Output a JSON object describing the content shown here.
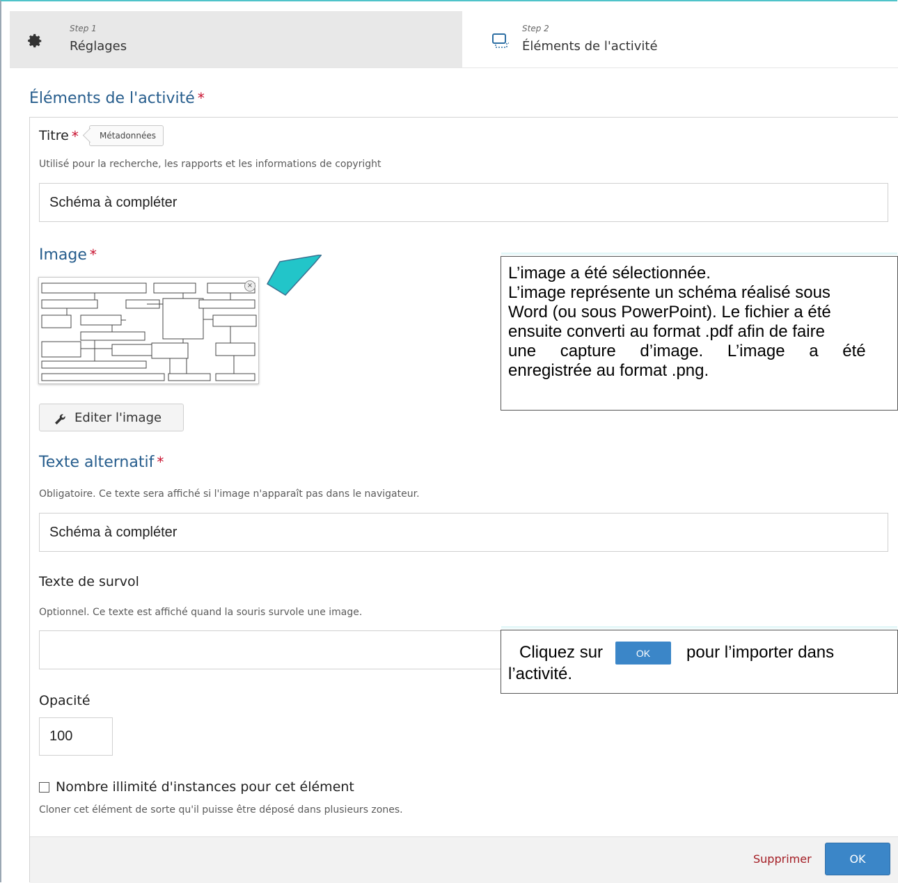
{
  "steps": [
    {
      "small": "Step 1",
      "label": "Réglages"
    },
    {
      "small": "Step 2",
      "label": "Éléments de l'activité"
    }
  ],
  "heading": "Éléments de l'activité",
  "titre": {
    "label": "Titre",
    "tag": "Métadonnées",
    "desc": "Utilisé pour la recherche, les rapports et les informations de copyright",
    "value": "Schéma à compléter"
  },
  "image": {
    "label": "Image",
    "edit_button": "Editer l'image",
    "close": "×"
  },
  "texte_alternatif": {
    "label": "Texte alternatif",
    "desc": "Obligatoire. Ce texte sera affiché si l'image n'apparaît pas dans le navigateur.",
    "value": "Schéma à compléter"
  },
  "texte_survol": {
    "label": "Texte de survol",
    "desc": "Optionnel. Ce texte est affiché quand la souris survole une image.",
    "value": ""
  },
  "opacite": {
    "label": "Opacité",
    "value": "100"
  },
  "instances": {
    "label": "Nombre illimité d'instances pour cet élément",
    "desc": "Cloner cet élément de sorte qu'il puisse être déposé dans plusieurs zones."
  },
  "footer": {
    "delete": "Supprimer",
    "ok": "OK"
  },
  "callout1": {
    "line1": "L’image a été sélectionnée.",
    "line2": "L’image représente un schéma réalisé sous",
    "line3": "Word (ou sous PowerPoint). Le fichier a été",
    "line4": "ensuite converti au format .pdf afin de faire",
    "line5": "une capture d’image. L’image a été",
    "line6": "enregistrée au format .png."
  },
  "callout2": {
    "before": "Cliquez sur",
    "button": "OK",
    "after": "pour l’importer dans",
    "line2": "l’activité."
  },
  "colors": {
    "accent_blue": "#255c8c",
    "button_blue": "#3b86c8",
    "required_red": "#c8102e",
    "delete_red": "#a31b22",
    "arrow_teal": "#22c5c9"
  }
}
